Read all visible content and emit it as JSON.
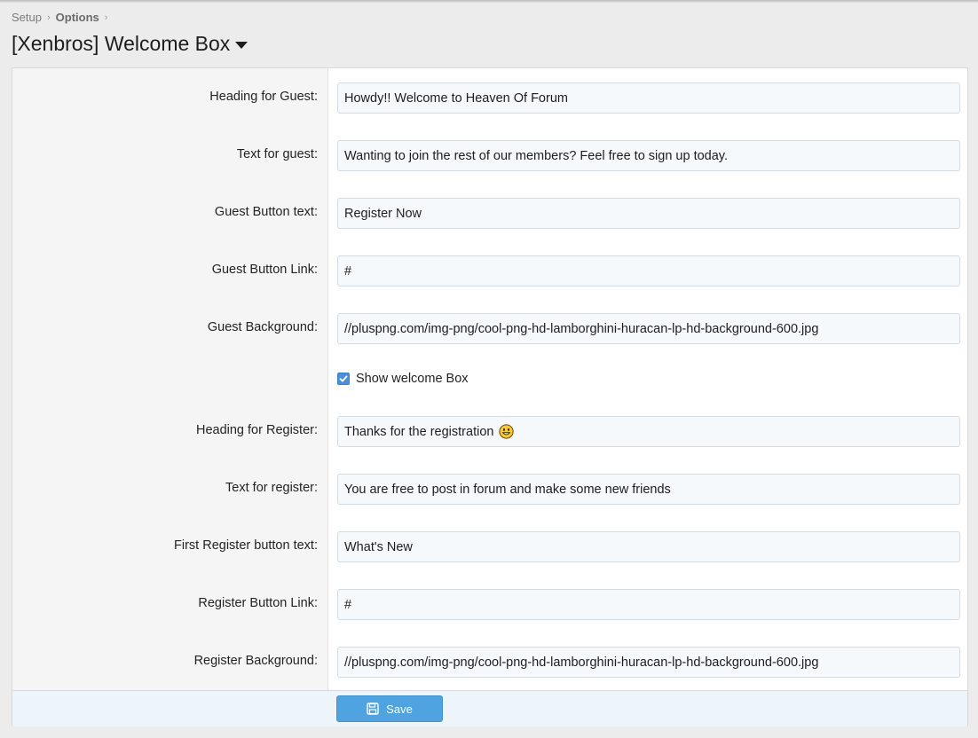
{
  "breadcrumb": {
    "items": [
      "Setup",
      "Options"
    ],
    "separator": "›"
  },
  "page": {
    "title": "[Xenbros] Welcome Box"
  },
  "form": {
    "heading_guest": {
      "label": "Heading for Guest:",
      "value": "Howdy!! Welcome to Heaven Of Forum"
    },
    "text_guest": {
      "label": "Text for guest:",
      "value": "Wanting to join the rest of our members? Feel free to sign up today."
    },
    "guest_button_text": {
      "label": "Guest Button text:",
      "value": "Register Now"
    },
    "guest_button_link": {
      "label": "Guest Button Link:",
      "value": "#"
    },
    "guest_background": {
      "label": "Guest Background:",
      "value": "//pluspng.com/img-png/cool-png-hd-lamborghini-huracan-lp-hd-background-600.jpg"
    },
    "show_welcome_box": {
      "label": "Show welcome Box",
      "checked": true
    },
    "heading_register": {
      "label": "Heading for Register:",
      "value": "Thanks for the registration",
      "emoji": "smiley-face-icon"
    },
    "text_register": {
      "label": "Text for register:",
      "value": "You are free to post in forum and make some new friends"
    },
    "first_register_button_text": {
      "label": "First Register button text:",
      "value": "What's New"
    },
    "register_button_link": {
      "label": "Register Button Link:",
      "value": "#"
    },
    "register_background": {
      "label": "Register Background:",
      "value": "//pluspng.com/img-png/cool-png-hd-lamborghini-huracan-lp-hd-background-600.jpg"
    }
  },
  "footer": {
    "save_label": "Save",
    "save_icon": "save-icon"
  },
  "colors": {
    "accent": "#4ea3e0",
    "checkbox": "#4a90d9",
    "field_bg": "#f6f9fc",
    "footer_bg": "#edf4fa"
  }
}
